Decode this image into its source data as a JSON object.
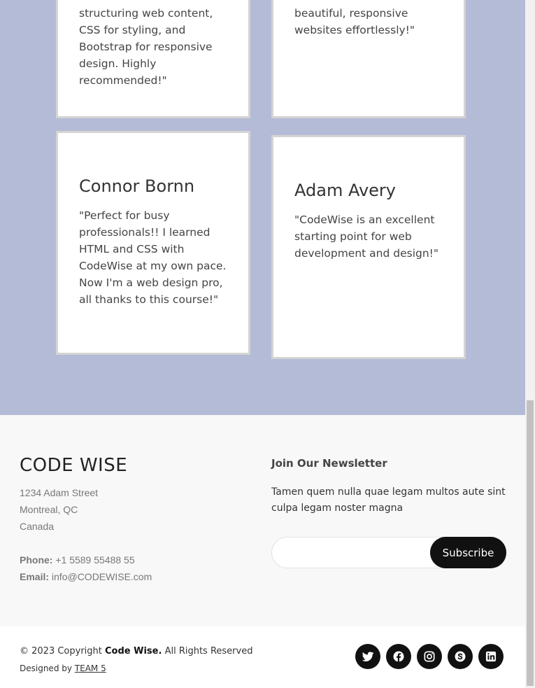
{
  "testimonials": [
    {
      "name": "",
      "quote": "structuring web content, CSS for styling, and Bootstrap for responsive design. Highly recommended!\""
    },
    {
      "name": "",
      "quote": "beautiful, responsive websites effortlessly!\""
    },
    {
      "name": "Connor Bornn",
      "quote": "\"Perfect for busy professionals!! I learned HTML and CSS with CodeWise at my own pace. Now I'm a web design pro, all thanks to this course!\""
    },
    {
      "name": "Adam Avery",
      "quote": "\"CodeWise is an excellent starting point for web development and design!\""
    }
  ],
  "footer": {
    "brand": "CODE WISE",
    "address": [
      "1234 Adam Street",
      "Montreal, QC",
      "Canada"
    ],
    "phone_label": "Phone:",
    "phone": "+1 5589 55488 55",
    "email_label": "Email:",
    "email": "info@CODEWISE.com",
    "newsletter": {
      "title": "Join Our Newsletter",
      "text": "Tamen quem nulla quae legam multos aute sint culpa legam noster magna",
      "input_value": "",
      "input_placeholder": "",
      "button_label": "Subscribe"
    },
    "copyright_prefix": "© 2023 Copyright",
    "copyright_brand": "Code Wise.",
    "copyright_suffix": "All Rights Reserved",
    "designed_prefix": "Designed by",
    "designed_link": "TEAM 5",
    "socials": [
      "twitter-icon",
      "facebook-icon",
      "instagram-icon",
      "skype-icon",
      "linkedin-icon"
    ]
  },
  "colors": {
    "testimonials_bg": "#b4bbd6",
    "footer_bg": "#f8f8f8",
    "button_bg": "#111111"
  }
}
